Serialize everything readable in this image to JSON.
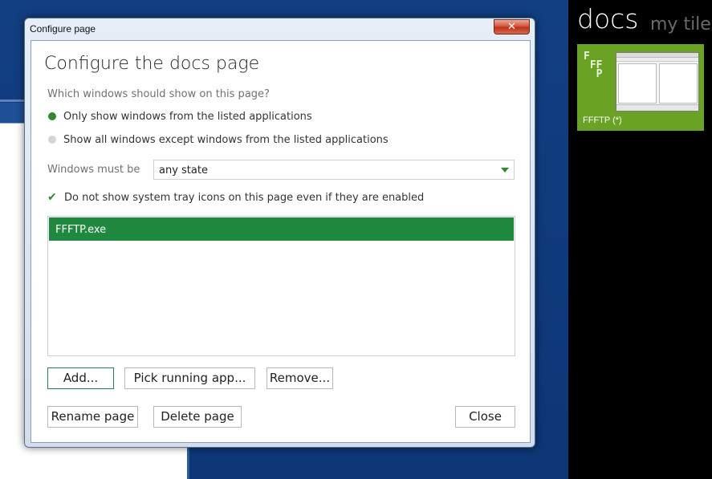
{
  "dialog": {
    "window_title": "Configure page",
    "close_glyph": "✕",
    "heading": "Configure the docs page",
    "question": "Which windows should show on this page?",
    "radio_only": "Only show windows from the listed applications",
    "radio_except": "Show all windows except windows from the listed applications",
    "state_label": "Windows must be",
    "state_value": "any state",
    "tray_checkbox": "Do not show system tray icons on this page even if they are enabled",
    "apps": [
      "FFFTP.exe"
    ],
    "buttons": {
      "add": "Add...",
      "pick_running": "Pick running app...",
      "remove": "Remove...",
      "rename": "Rename page",
      "delete": "Delete page",
      "close": "Close"
    }
  },
  "side_panel": {
    "title": "docs",
    "subtitle": "my tiles",
    "tile": {
      "label": "FFFTP (*)",
      "color": "#6aa324"
    }
  },
  "colors": {
    "accent_green": "#2e8b2e",
    "selection_green": "#1f8a3f",
    "desktop_blue": "#0e3b7c"
  }
}
